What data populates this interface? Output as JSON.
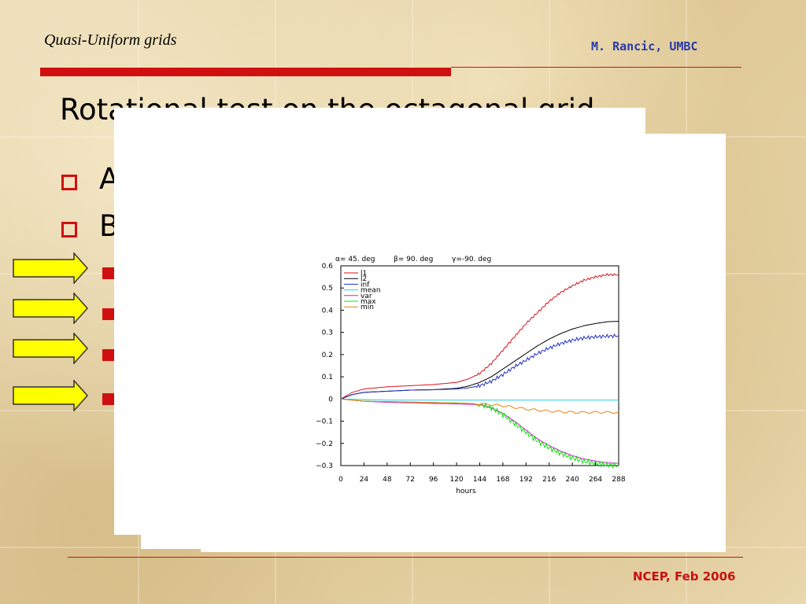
{
  "header": {
    "left_title": "Quasi-Uniform grids",
    "right_author": "M. Rancic, UMBC"
  },
  "slide": {
    "title": "Rotational test on the octagonal grid",
    "bullets": [
      "A",
      "B"
    ],
    "sub_bullet_count": 4
  },
  "footer": {
    "right": "NCEP, Feb 2006"
  },
  "colors": {
    "accent_red": "#d01010",
    "author_blue": "#2a3aa8",
    "arrow_yellow": "#ffff00"
  },
  "chart_data": {
    "type": "line",
    "title_params": [
      "α= 45. deg",
      "β= 90. deg",
      "γ=-90. deg"
    ],
    "xlabel": "hours",
    "ylabel": "",
    "x_ticks": [
      0,
      24,
      48,
      72,
      96,
      120,
      144,
      168,
      192,
      216,
      240,
      264,
      288
    ],
    "y_ticks": [
      -0.3,
      -0.2,
      -0.1,
      0,
      0.1,
      0.2,
      0.3,
      0.4,
      0.5,
      0.6
    ],
    "xlim": [
      0,
      288
    ],
    "ylim": [
      -0.3,
      0.6
    ],
    "legend_position": "top-left",
    "series": [
      {
        "name": "l1",
        "color": "#e0101a",
        "x": [
          0,
          12,
          24,
          48,
          72,
          96,
          120,
          132,
          144,
          156,
          168,
          180,
          192,
          204,
          216,
          228,
          240,
          252,
          264,
          276,
          288
        ],
        "values": [
          0,
          0.03,
          0.045,
          0.055,
          0.06,
          0.065,
          0.075,
          0.09,
          0.115,
          0.16,
          0.22,
          0.28,
          0.34,
          0.39,
          0.44,
          0.48,
          0.51,
          0.535,
          0.55,
          0.56,
          0.56
        ]
      },
      {
        "name": "l2",
        "color": "#000000",
        "x": [
          0,
          12,
          24,
          48,
          72,
          96,
          120,
          132,
          144,
          156,
          168,
          180,
          192,
          204,
          216,
          228,
          240,
          252,
          264,
          276,
          288
        ],
        "values": [
          0,
          0.02,
          0.03,
          0.035,
          0.04,
          0.042,
          0.048,
          0.058,
          0.075,
          0.1,
          0.135,
          0.17,
          0.205,
          0.24,
          0.27,
          0.295,
          0.315,
          0.33,
          0.34,
          0.348,
          0.35
        ]
      },
      {
        "name": "inf",
        "color": "#2030c0",
        "x": [
          0,
          12,
          24,
          48,
          72,
          96,
          120,
          132,
          144,
          156,
          168,
          180,
          192,
          204,
          216,
          228,
          240,
          252,
          264,
          276,
          288
        ],
        "values": [
          0,
          0.02,
          0.03,
          0.035,
          0.04,
          0.042,
          0.045,
          0.05,
          0.06,
          0.08,
          0.11,
          0.145,
          0.175,
          0.205,
          0.23,
          0.25,
          0.265,
          0.275,
          0.28,
          0.283,
          0.285
        ]
      },
      {
        "name": "mean",
        "color": "#20d0e0",
        "x": [
          0,
          48,
          96,
          144,
          192,
          240,
          288
        ],
        "values": [
          0,
          -0.005,
          -0.005,
          -0.005,
          -0.005,
          -0.005,
          -0.005
        ]
      },
      {
        "name": "var",
        "color": "#e010e0",
        "x": [
          0,
          24,
          48,
          72,
          96,
          120,
          144,
          156,
          168,
          180,
          192,
          204,
          216,
          228,
          240,
          252,
          264,
          276,
          288
        ],
        "values": [
          0,
          -0.01,
          -0.015,
          -0.017,
          -0.02,
          -0.022,
          -0.025,
          -0.04,
          -0.065,
          -0.1,
          -0.14,
          -0.18,
          -0.21,
          -0.235,
          -0.255,
          -0.27,
          -0.28,
          -0.288,
          -0.29
        ]
      },
      {
        "name": "max",
        "color": "#10e010",
        "x": [
          0,
          24,
          48,
          72,
          96,
          120,
          144,
          156,
          168,
          180,
          192,
          204,
          216,
          228,
          240,
          252,
          264,
          276,
          288
        ],
        "values": [
          0,
          -0.01,
          -0.012,
          -0.014,
          -0.016,
          -0.018,
          -0.022,
          -0.04,
          -0.07,
          -0.11,
          -0.15,
          -0.19,
          -0.22,
          -0.245,
          -0.265,
          -0.28,
          -0.29,
          -0.296,
          -0.3
        ]
      },
      {
        "name": "min",
        "color": "#f08010",
        "x": [
          0,
          24,
          48,
          72,
          96,
          120,
          144,
          168,
          192,
          216,
          240,
          264,
          288
        ],
        "values": [
          0,
          -0.01,
          -0.012,
          -0.014,
          -0.016,
          -0.018,
          -0.022,
          -0.03,
          -0.045,
          -0.055,
          -0.06,
          -0.06,
          -0.06
        ]
      }
    ]
  }
}
